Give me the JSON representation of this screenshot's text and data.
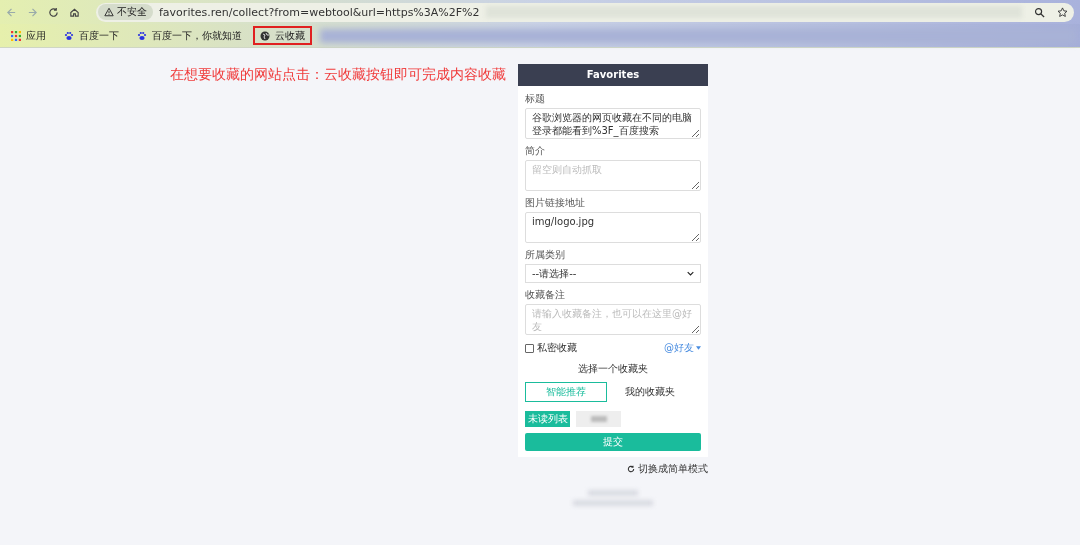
{
  "browser": {
    "security_label": "不安全",
    "url": "favorites.ren/collect?from=webtool&url=https%3A%2F%2"
  },
  "bookmarks": [
    {
      "label": "应用",
      "kind": "apps",
      "highlighted": false
    },
    {
      "label": "百度一下",
      "kind": "paw",
      "highlighted": false
    },
    {
      "label": "百度一下，你就知道",
      "kind": "paw",
      "highlighted": false
    },
    {
      "label": "云收藏",
      "kind": "globe",
      "highlighted": true
    }
  ],
  "annotation": "在想要收藏的网站点击：云收藏按钮即可完成内容收藏",
  "panel": {
    "title": "Favorites",
    "fields": [
      {
        "label": "标题",
        "kind": "textarea",
        "value": "谷歌浏览器的网页收藏在不同的电脑登录都能看到%3F_百度搜索"
      },
      {
        "label": "简介",
        "kind": "textarea",
        "placeholder": "留空则自动抓取"
      },
      {
        "label": "图片链接地址",
        "kind": "textarea",
        "value": "img/logo.jpg"
      },
      {
        "label": "所属类别",
        "kind": "select",
        "value": "--请选择--"
      },
      {
        "label": "收藏备注",
        "kind": "textarea",
        "placeholder": "请输入收藏备注，也可以在这里@好友"
      }
    ],
    "private": {
      "label": "私密收藏",
      "checked": false
    },
    "mention_link": "@好友",
    "folder_prompt": "选择一个收藏夹",
    "folder_tabs": [
      {
        "label": "智能推荐",
        "selected": true
      },
      {
        "label": "我的收藏夹",
        "selected": false
      }
    ],
    "folders": [
      {
        "label": "未读列表",
        "selected": true
      },
      {
        "selected": false
      }
    ],
    "submit": "提交"
  },
  "switch_link": "切换成简单模式"
}
